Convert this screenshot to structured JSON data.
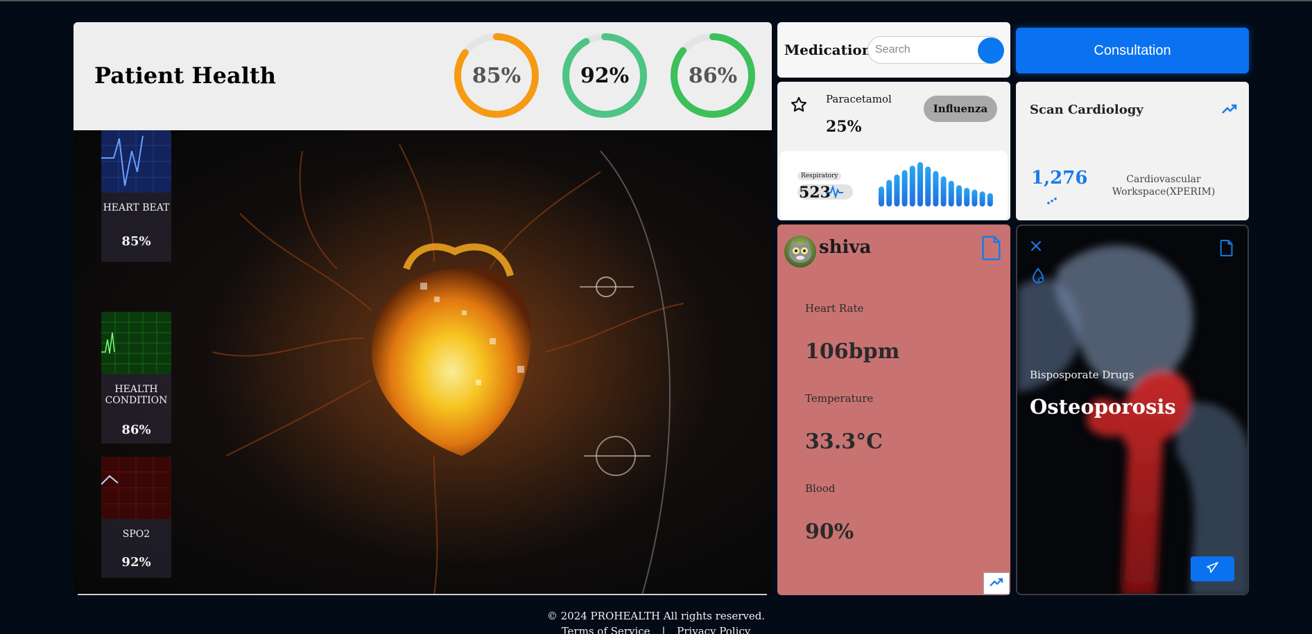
{
  "header": {
    "title": "Patient Health",
    "rings": [
      {
        "label": "85%",
        "value": 0.85,
        "color": "#f59a12",
        "text_color": "#555555"
      },
      {
        "label": "92%",
        "value": 0.92,
        "color": "#4ec487",
        "text_color": "#111111"
      },
      {
        "label": "86%",
        "value": 0.86,
        "color": "#3dbf5a",
        "text_color": "#555555"
      }
    ]
  },
  "vitals": [
    {
      "name": "HEART BEAT",
      "value": "85%",
      "color": "#1f3a8c"
    },
    {
      "name": "HEALTH CONDITION",
      "value": "86%",
      "color": "#0f5a12"
    },
    {
      "name": "SPO2",
      "value": "92%",
      "color": "#5a0d0d"
    }
  ],
  "medication": {
    "title": "Medication",
    "search_placeholder": "Search"
  },
  "consultation": {
    "label": "Consultation"
  },
  "drug": {
    "name": "Paracetamol",
    "percent": "25%",
    "tag": "Influenza"
  },
  "respiratory": {
    "label": "Respiratory",
    "value": "523",
    "bars": [
      0.45,
      0.6,
      0.72,
      0.82,
      0.92,
      1.0,
      0.9,
      0.8,
      0.68,
      0.58,
      0.48,
      0.42,
      0.38,
      0.34,
      0.3
    ]
  },
  "scan": {
    "title": "Scan Cardiology",
    "count": "1,276",
    "description": "Cardiovascular Workspace(XPERIM)"
  },
  "patient": {
    "name": "shiva",
    "metrics": [
      {
        "label": "Heart Rate",
        "value": "106bpm"
      },
      {
        "label": "Temperature",
        "value": "33.3°C"
      },
      {
        "label": "Blood",
        "value": "90%"
      }
    ]
  },
  "condition": {
    "subtitle": "Bisposporate Drugs",
    "title": "Osteoporosis"
  },
  "footer": {
    "copyright": "© 2024 PROHEALTH All rights reserved.",
    "links": [
      "Terms of Service",
      "|",
      "Privacy Policy"
    ]
  },
  "colors": {
    "accent": "#0a72f0",
    "patient_card": "#c87372",
    "background": "#030b17"
  }
}
